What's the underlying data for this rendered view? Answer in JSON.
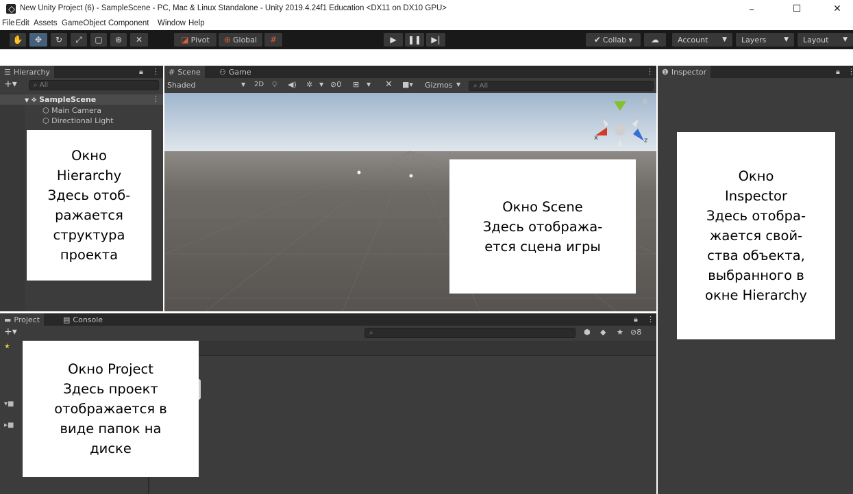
{
  "window": {
    "title": "New Unity Project (6) - SampleScene - PC, Mac & Linux Standalone - Unity 2019.4.24f1 Education <DX11 on DX10 GPU>",
    "minimize": "–",
    "maximize": "☐",
    "close": "✕"
  },
  "menu": [
    "File",
    "Edit",
    "Assets",
    "GameObject",
    "Component",
    "Window",
    "Help"
  ],
  "toolbar": {
    "pivot": "Pivot",
    "global": "Global",
    "collab": "Collab ▾",
    "account": "Account",
    "layers": "Layers",
    "layout": "Layout"
  },
  "hierarchy": {
    "tab": "Hierarchy",
    "search_placeholder": "All",
    "scene": "SampleScene",
    "items": [
      "Main Camera",
      "Directional Light"
    ]
  },
  "scene": {
    "tab_scene": "Scene",
    "tab_game": "Game",
    "shading": "Shaded",
    "mode_2d": "2D",
    "hidden_count": "0",
    "gizmos": "Gizmos",
    "search_placeholder": "All",
    "axis_x": "x",
    "axis_z": "z"
  },
  "inspector": {
    "tab": "Inspector"
  },
  "project": {
    "tab_project": "Project",
    "tab_console": "Console",
    "hidden_count": "8"
  },
  "notes": {
    "hierarchy": "Окно\nHierarchy\nЗдесь отоб-\nражается\nструктура\nпроекта",
    "scene": "Окно Scene\nЗдесь отобража-\nется сцена игры",
    "inspector": "Окно\nInspector\nЗдесь отобра-\nжается свой-\nства объекта,\nвыбранного в\nокне Hierarchy",
    "project": "Окно Project\nЗдесь проект\nотображается в\nвиде папок на\nдиске"
  },
  "colors": {
    "editor_bg": "#3c3c3c",
    "toolbar_bg": "#191919",
    "tab_strip": "#282828",
    "scene_sky": "#c9d6e3",
    "scene_ground": "#5e5a56",
    "gizmo_x": "#d23a2a",
    "gizmo_y": "#86c02e",
    "gizmo_z": "#3a6ed2"
  }
}
